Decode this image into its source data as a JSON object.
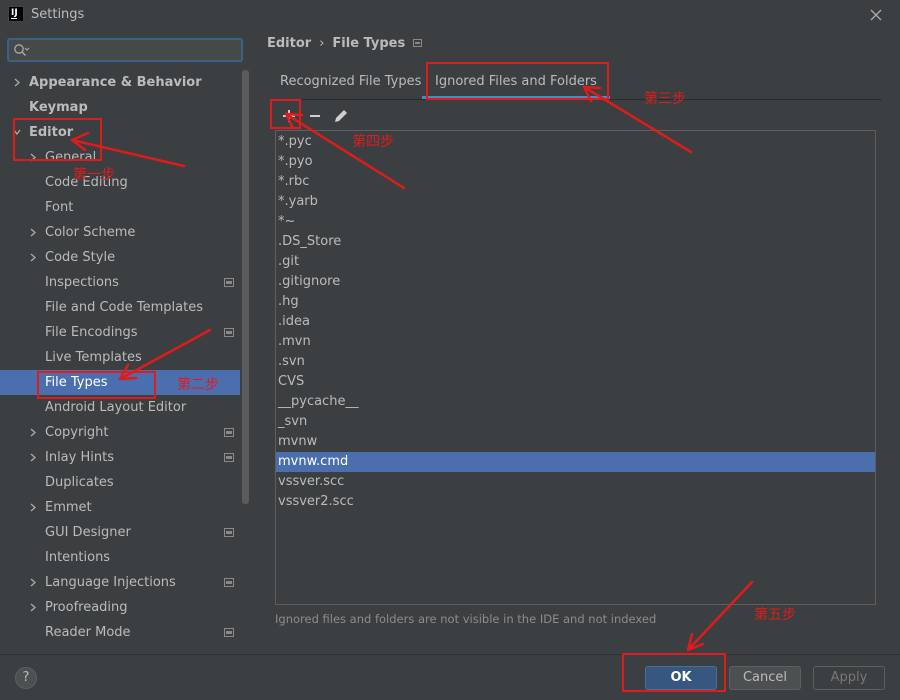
{
  "window": {
    "title": "Settings",
    "logo_text": "IJ"
  },
  "search": {
    "placeholder": "",
    "value": ""
  },
  "sidebar": {
    "items": [
      {
        "label": "Appearance & Behavior",
        "bold": true,
        "expandable": true,
        "expanded": false,
        "indent": 0
      },
      {
        "label": "Keymap",
        "bold": true,
        "expandable": false,
        "indent": 0
      },
      {
        "label": "Editor",
        "bold": true,
        "expandable": true,
        "expanded": true,
        "indent": 0
      },
      {
        "label": "General",
        "expandable": true,
        "expanded": false,
        "indent": 1
      },
      {
        "label": "Code Editing",
        "expandable": false,
        "indent": 1
      },
      {
        "label": "Font",
        "expandable": false,
        "indent": 1
      },
      {
        "label": "Color Scheme",
        "expandable": true,
        "expanded": false,
        "indent": 1
      },
      {
        "label": "Code Style",
        "expandable": true,
        "expanded": false,
        "indent": 1
      },
      {
        "label": "Inspections",
        "expandable": false,
        "indent": 1,
        "project_icon": true
      },
      {
        "label": "File and Code Templates",
        "expandable": false,
        "indent": 1
      },
      {
        "label": "File Encodings",
        "expandable": false,
        "indent": 1,
        "project_icon": true
      },
      {
        "label": "Live Templates",
        "expandable": false,
        "indent": 1
      },
      {
        "label": "File Types",
        "expandable": false,
        "indent": 1,
        "selected": true
      },
      {
        "label": "Android Layout Editor",
        "expandable": false,
        "indent": 1
      },
      {
        "label": "Copyright",
        "expandable": true,
        "expanded": false,
        "indent": 1,
        "project_icon": true
      },
      {
        "label": "Inlay Hints",
        "expandable": true,
        "expanded": false,
        "indent": 1,
        "project_icon": true
      },
      {
        "label": "Duplicates",
        "expandable": false,
        "indent": 1
      },
      {
        "label": "Emmet",
        "expandable": true,
        "expanded": false,
        "indent": 1
      },
      {
        "label": "GUI Designer",
        "expandable": false,
        "indent": 1,
        "project_icon": true
      },
      {
        "label": "Intentions",
        "expandable": false,
        "indent": 1
      },
      {
        "label": "Language Injections",
        "expandable": true,
        "expanded": false,
        "indent": 1,
        "project_icon": true
      },
      {
        "label": "Proofreading",
        "expandable": true,
        "expanded": false,
        "indent": 1
      },
      {
        "label": "Reader Mode",
        "expandable": false,
        "indent": 1,
        "project_icon": true
      }
    ]
  },
  "breadcrumb": {
    "parent": "Editor",
    "separator": "›",
    "current": "File Types"
  },
  "tabs": [
    {
      "label": "Recognized File Types",
      "active": false
    },
    {
      "label": "Ignored Files and Folders",
      "active": true
    }
  ],
  "toolbar": {
    "add_icon": "plus-icon",
    "remove_icon": "minus-icon",
    "edit_icon": "pencil-icon"
  },
  "ignored_list": [
    "*.pyc",
    "*.pyo",
    "*.rbc",
    "*.yarb",
    "*~",
    ".DS_Store",
    ".git",
    ".gitignore",
    ".hg",
    ".idea",
    ".mvn",
    ".svn",
    "CVS",
    "__pycache__",
    "_svn",
    "mvnw",
    "mvnw.cmd",
    "vssver.scc",
    "vssver2.scc"
  ],
  "selected_list_item": "mvnw.cmd",
  "hint": "Ignored files and folders are not visible in the IDE and not indexed",
  "buttons": {
    "help": "?",
    "ok": "OK",
    "cancel": "Cancel",
    "apply": "Apply"
  },
  "annotations": {
    "step1": "第一步",
    "step2": "第二步",
    "step3": "第三步",
    "step4": "第四步",
    "step5": "第五步",
    "color": "#e01b1b"
  },
  "colors": {
    "selection": "#4b6eaf",
    "accent": "#4a88c7",
    "ok_button": "#365880"
  }
}
